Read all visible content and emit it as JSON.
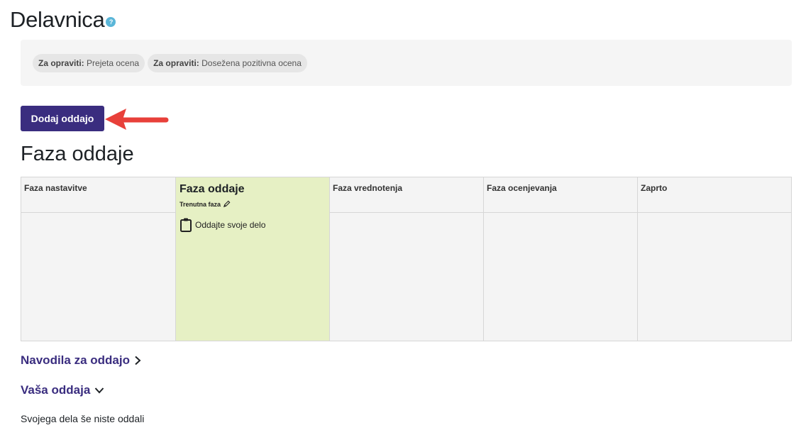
{
  "page": {
    "title": "Delavnica"
  },
  "completion": {
    "items": [
      {
        "label": "Za opraviti:",
        "value": "Prejeta ocena"
      },
      {
        "label": "Za opraviti:",
        "value": "Dosežena pozitivna ocena"
      }
    ]
  },
  "actions": {
    "add_submission": "Dodaj oddajo"
  },
  "phase_heading": "Faza oddaje",
  "phases": {
    "setup": "Faza nastavitve",
    "submission": "Faza oddaje",
    "current_label": "Trenutna faza",
    "task": "Oddajte svoje delo",
    "assessment": "Faza vrednotenja",
    "grading": "Faza ocenjevanja",
    "closed": "Zaprto"
  },
  "sections": {
    "instructions": "Navodila za oddajo",
    "your_submission": "Vaša oddaja",
    "no_submission": "Svojega dela še niste oddali"
  },
  "colors": {
    "primary": "#3a2d7f",
    "active_phase": "#e6f0c4",
    "annotation_arrow": "#e8403a"
  },
  "icons": [
    "help-icon",
    "pencil-icon",
    "clipboard-icon",
    "chevron-right-icon",
    "chevron-down-icon"
  ]
}
